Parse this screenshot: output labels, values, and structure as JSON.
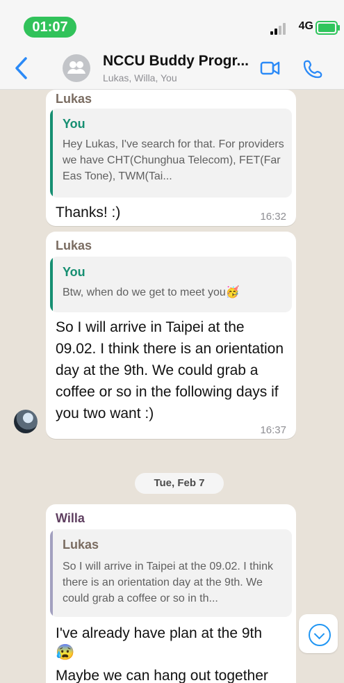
{
  "status_bar": {
    "time": "01:07",
    "network": "4G"
  },
  "header": {
    "title": "NCCU Buddy Progr...",
    "subtitle": "Lukas, Willa, You"
  },
  "messages": [
    {
      "sender": "Lukas",
      "sender_color": "#7a6c61",
      "quote_name": "You",
      "quote_name_color": "#168f72",
      "quote_bar_color": "#168f72",
      "quote_text": "Hey Lukas, I've search for that. For providers we have CHT(Chunghua Telecom), FET(Far Eas Tone), TWM(Tai...",
      "text": "Thanks! :)",
      "time": "16:32"
    },
    {
      "sender": "Lukas",
      "sender_color": "#7a6c61",
      "quote_name": "You",
      "quote_name_color": "#168f72",
      "quote_bar_color": "#168f72",
      "quote_text": "Btw, when do we get to meet you🥳",
      "text": "So I will arrive in Taipei at the 09.02. I think there is an orientation day at the 9th. We could grab a coffee or so in the following days if you two want :)",
      "time": "16:37"
    },
    {
      "sender": "Willa",
      "sender_color": "#5f3f60",
      "quote_name": "Lukas",
      "quote_name_color": "#7a6c61",
      "quote_bar_color": "#a2a0bf",
      "quote_text": "So I will arrive in Taipei at the 09.02. I think there is an orientation day at the 9th. We could grab a coffee or so in th...",
      "text_line_1": "I've already have plan at the 9th",
      "text_emoji": "😰",
      "text_line_3": "Maybe we can hang out together"
    }
  ],
  "date_divider": "Tue, Feb 7",
  "colors": {
    "accent": "#2b8af7",
    "status_green": "#31c25a"
  }
}
